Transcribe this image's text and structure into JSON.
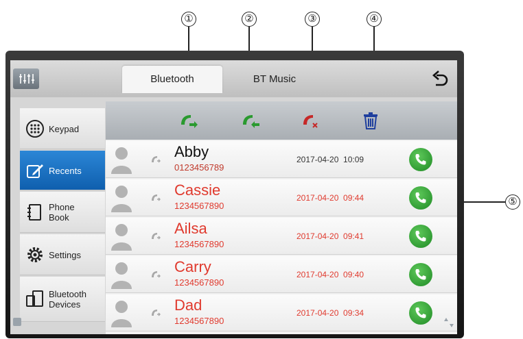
{
  "callouts": [
    "①",
    "②",
    "③",
    "④",
    "⑤"
  ],
  "header": {
    "tabs": [
      {
        "label": "Bluetooth",
        "active": true
      },
      {
        "label": "BT Music",
        "active": false
      }
    ]
  },
  "sidebar": {
    "items": [
      {
        "label": "Keypad",
        "icon": "keypad-icon",
        "active": false
      },
      {
        "label": "Recents",
        "icon": "recents-icon",
        "active": true
      },
      {
        "label": "Phone\nBook",
        "icon": "phonebook-icon",
        "active": false
      },
      {
        "label": "Settings",
        "icon": "settings-gear-icon",
        "active": false
      },
      {
        "label": "Bluetooth\nDevices",
        "icon": "bluetooth-devices-icon",
        "active": false
      }
    ]
  },
  "toolbar": {
    "filters": [
      "outgoing-calls-icon",
      "incoming-calls-icon",
      "missed-calls-icon",
      "delete-trash-icon"
    ]
  },
  "calls": [
    {
      "name": "Abby",
      "number": "0123456789",
      "time": "2017-04-20  10:09",
      "missed": false
    },
    {
      "name": "Cassie",
      "number": "1234567890",
      "time": "2017-04-20  09:44",
      "missed": true
    },
    {
      "name": "Ailsa",
      "number": "1234567890",
      "time": "2017-04-20  09:41",
      "missed": true
    },
    {
      "name": "Carry",
      "number": "1234567890",
      "time": "2017-04-20  09:40",
      "missed": true
    },
    {
      "name": "Dad",
      "number": "1234567890",
      "time": "2017-04-20  09:34",
      "missed": true
    }
  ],
  "colors": {
    "missed": "#e03a2e",
    "normal_name": "#111111",
    "normal_number": "#c0392b",
    "time_normal": "#333333",
    "accent_blue": "#0f5fae",
    "call_green": "#2a9a2f",
    "missed_icon_red": "#c62828"
  }
}
